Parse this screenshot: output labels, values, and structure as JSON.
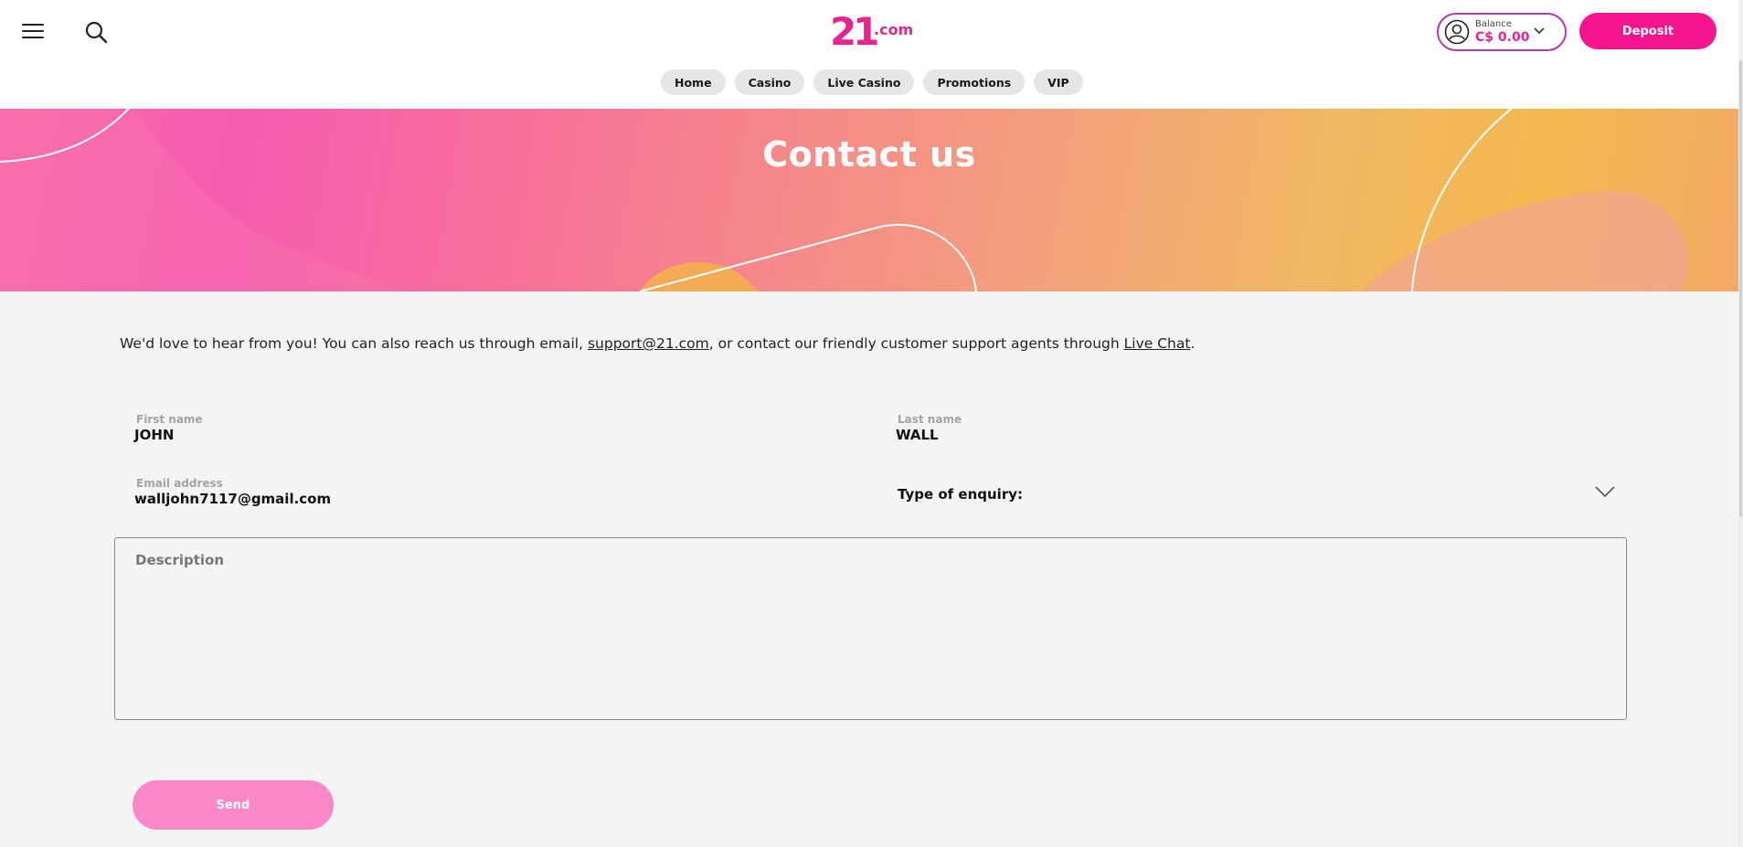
{
  "header": {
    "logo_number": "21",
    "logo_suffix": ".com",
    "balance_label": "Balance",
    "balance_value": "C$ 0.00",
    "deposit_label": "Deposit",
    "menu_icon": "hamburger-icon",
    "search_icon": "search-icon"
  },
  "nav": {
    "items": [
      {
        "label": "Home"
      },
      {
        "label": "Casino"
      },
      {
        "label": "Live Casino"
      },
      {
        "label": "Promotions"
      },
      {
        "label": "VIP"
      }
    ]
  },
  "hero": {
    "title": "Contact us"
  },
  "intro": {
    "text_before": "We'd love to hear from you! You can also reach us through email, ",
    "email_link": "support@21.com",
    "text_middle": ", or contact our friendly customer support agents through ",
    "chat_link": "Live Chat",
    "text_after": "."
  },
  "form": {
    "first_name_label": "First name",
    "first_name_value": "JOHN",
    "last_name_label": "Last name",
    "last_name_value": "WALL",
    "email_label": "Email address",
    "email_value": "walljohn7117@gmail.com",
    "enquiry_label": "Type of enquiry:",
    "description_label": "Description",
    "send_label": "Send"
  },
  "colors": {
    "brand_pink": "#f5168d",
    "send_disabled": "#fb88c6",
    "balance_border": "#b63aa6"
  }
}
